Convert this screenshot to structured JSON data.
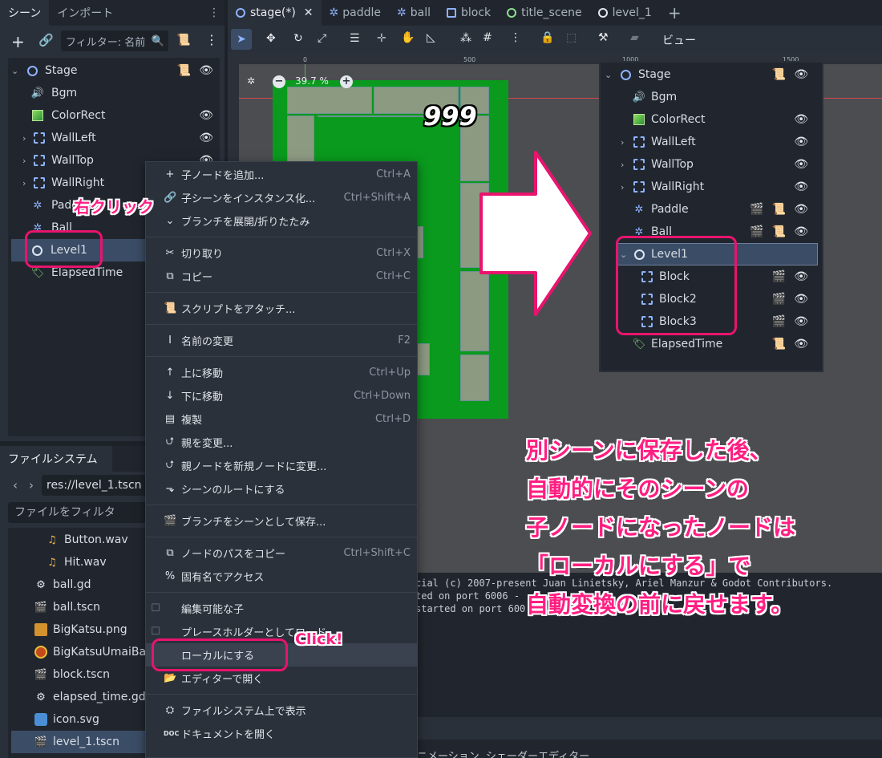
{
  "scene_dock": {
    "tabs": [
      "シーン",
      "インポート"
    ],
    "filter_placeholder": "フィルター: 名前",
    "nodes": [
      {
        "name": "Stage",
        "icon": "node-circle-icon"
      },
      {
        "name": "Bgm",
        "icon": "speaker-icon"
      },
      {
        "name": "ColorRect",
        "icon": "color-rect-icon"
      },
      {
        "name": "WallLeft",
        "icon": "static-body-icon"
      },
      {
        "name": "WallTop",
        "icon": "static-body-icon"
      },
      {
        "name": "WallRight",
        "icon": "static-body-icon"
      },
      {
        "name": "Paddle",
        "icon": "character-icon"
      },
      {
        "name": "Ball",
        "icon": "character-icon"
      },
      {
        "name": "Level1",
        "icon": "node-circle-icon"
      },
      {
        "name": "ElapsedTime",
        "icon": "label-icon"
      }
    ]
  },
  "editor_tabs": [
    "stage(*)",
    "paddle",
    "ball",
    "block",
    "title_scene",
    "level_1"
  ],
  "toolbar": {
    "view_label": "ビュー"
  },
  "viewport": {
    "zoom": "39.7 %",
    "ruler_0": "0",
    "ruler_500": "500",
    "ruler_1000": "1000",
    "ruler_1500": "1500",
    "score": "999"
  },
  "filesystem": {
    "tab": "ファイルシステム",
    "path": "res://level_1.tscn",
    "filter_placeholder": "ファイルをフィルタ",
    "files": [
      {
        "name": "Button.wav",
        "icon": "audio-file-icon"
      },
      {
        "name": "Hit.wav",
        "icon": "audio-file-icon"
      },
      {
        "name": "ball.gd",
        "icon": "gear-icon"
      },
      {
        "name": "ball.tscn",
        "icon": "scene-clapper-icon"
      },
      {
        "name": "BigKatsu.png",
        "icon": "image-icon"
      },
      {
        "name": "BigKatsuUmaiBal",
        "icon": "image-icon"
      },
      {
        "name": "block.tscn",
        "icon": "scene-clapper-icon"
      },
      {
        "name": "elapsed_time.gd",
        "icon": "gear-icon"
      },
      {
        "name": "icon.svg",
        "icon": "image-icon"
      },
      {
        "name": "level_1.tscn",
        "icon": "scene-clapper-icon"
      }
    ]
  },
  "output": {
    "line1": "cial (c) 2007-present Juan Linietsky, Ariel Manzur & Godot Contributors.",
    "line2": "ted on port 6006 -",
    "line3": "started on port 600"
  },
  "bottom_tabs": "ニメーション  シェーダーエディター",
  "context_menu": {
    "items": [
      {
        "label": "子ノードを追加...",
        "shortcut": "Ctrl+A",
        "icon": "+"
      },
      {
        "label": "子シーンをインスタンス化...",
        "shortcut": "Ctrl+Shift+A",
        "icon": "🔗"
      },
      {
        "label": "ブランチを展開/折りたたみ",
        "shortcut": "",
        "icon": "⌄"
      },
      {
        "sep": true
      },
      {
        "label": "切り取り",
        "shortcut": "Ctrl+X",
        "icon": "✂"
      },
      {
        "label": "コピー",
        "shortcut": "Ctrl+C",
        "icon": "⧉"
      },
      {
        "sep": true
      },
      {
        "label": "スクリプトをアタッチ...",
        "shortcut": "",
        "icon": "📜"
      },
      {
        "sep": true
      },
      {
        "label": "名前の変更",
        "shortcut": "F2",
        "icon": "I"
      },
      {
        "sep": true
      },
      {
        "label": "上に移動",
        "shortcut": "Ctrl+Up",
        "icon": "↑"
      },
      {
        "label": "下に移動",
        "shortcut": "Ctrl+Down",
        "icon": "↓"
      },
      {
        "label": "複製",
        "shortcut": "Ctrl+D",
        "icon": "▤"
      },
      {
        "label": "親を変更...",
        "shortcut": "",
        "icon": "⮍"
      },
      {
        "label": "親ノードを新規ノードに変更...",
        "shortcut": "",
        "icon": "⮍"
      },
      {
        "label": "シーンのルートにする",
        "shortcut": "",
        "icon": "⬎"
      },
      {
        "sep": true
      },
      {
        "label": "ブランチをシーンとして保存...",
        "shortcut": "",
        "icon": "🎬"
      },
      {
        "sep": true
      },
      {
        "label": "ノードのパスをコピー",
        "shortcut": "Ctrl+Shift+C",
        "icon": "⧉"
      },
      {
        "label": "固有名でアクセス",
        "shortcut": "",
        "icon": "%"
      },
      {
        "sep": true
      },
      {
        "label": "編集可能な子",
        "shortcut": "",
        "icon": "☐"
      },
      {
        "label": "プレースホルダーとしてロード",
        "shortcut": "",
        "icon": "☐"
      },
      {
        "label": "ローカルにする",
        "shortcut": "",
        "icon": "",
        "highlight": true
      },
      {
        "label": "エディターで開く",
        "shortcut": "",
        "icon": "📂"
      },
      {
        "sep": true
      },
      {
        "label": "ファイルシステム上で表示",
        "shortcut": "",
        "icon": "⛭"
      },
      {
        "label": "ドキュメントを開く",
        "shortcut": "",
        "icon": "DOC"
      }
    ]
  },
  "zoom_tree": {
    "nodes": [
      {
        "name": "Stage"
      },
      {
        "name": "Bgm"
      },
      {
        "name": "ColorRect"
      },
      {
        "name": "WallLeft"
      },
      {
        "name": "WallTop"
      },
      {
        "name": "WallRight"
      },
      {
        "name": "Paddle"
      },
      {
        "name": "Ball"
      },
      {
        "name": "Level1"
      },
      {
        "name": "Block"
      },
      {
        "name": "Block2"
      },
      {
        "name": "Block3"
      },
      {
        "name": "ElapsedTime"
      }
    ]
  },
  "annotations": {
    "right_click": "右クリック",
    "click": "Click!",
    "line1": "別シーンに保存した後、",
    "line2": "自動的にそのシーンの",
    "line3": "子ノードになったノードは",
    "line4": "「ローカルにする」で",
    "line5": "自動変換の前に戻せます。"
  },
  "colors": {
    "accent_pink": "#e8146e",
    "panel": "#2a303a",
    "selection": "#3b4d66",
    "node_blue": "#8fb2ff",
    "grass": "#0a9a1e"
  }
}
